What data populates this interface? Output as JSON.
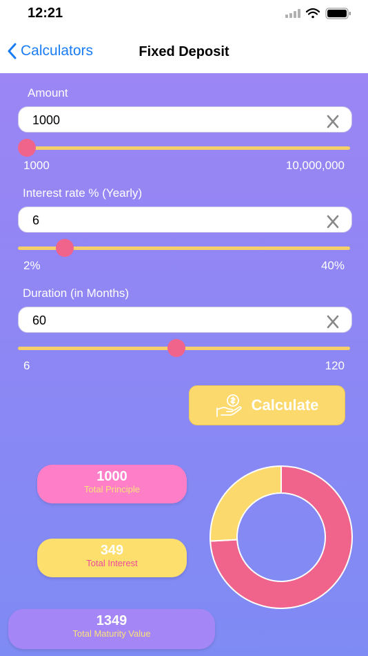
{
  "status_bar": {
    "time": "12:21"
  },
  "nav": {
    "back_label": "Calculators",
    "title": "Fixed Deposit"
  },
  "amount": {
    "label": "Amount",
    "value": "1000",
    "min_label": "1000",
    "max_label": "10,000,000",
    "slider_fraction": 0.0
  },
  "interest": {
    "label": "Interest rate % (Yearly)",
    "value": "6",
    "min_label": "2%",
    "max_label": "40%",
    "slider_fraction": 0.12
  },
  "duration": {
    "label": "Duration (in Months)",
    "value": "60",
    "min_label": "6",
    "max_label": "120",
    "slider_fraction": 0.475
  },
  "clear_label": "X",
  "calculate_label": "Calculate",
  "results": {
    "principle": {
      "value": "1000",
      "caption": "Total Principle"
    },
    "interest": {
      "value": "349",
      "caption": "Total Interest"
    },
    "maturity": {
      "value": "1349",
      "caption": "Total Maturity Value"
    }
  },
  "chart_data": {
    "type": "pie",
    "donut": true,
    "categories": [
      "Total Principle",
      "Total Interest"
    ],
    "values": [
      1000,
      349
    ],
    "colors": [
      "#f0648c",
      "#fbd96c"
    ]
  },
  "colors": {
    "accent": "#1a7cf5",
    "slider_track": "#f5cf6a",
    "slider_thumb": "#f0648c",
    "principle_pill": "#ff7ec8",
    "interest_pill": "#fddf6e",
    "maturity_pill": "#a586f6"
  },
  "icons": {
    "back": "chevron-left-icon",
    "clear": "close-icon",
    "calculate": "money-hand-icon",
    "signal": "cellular-signal-icon",
    "wifi": "wifi-icon",
    "battery": "battery-icon"
  }
}
